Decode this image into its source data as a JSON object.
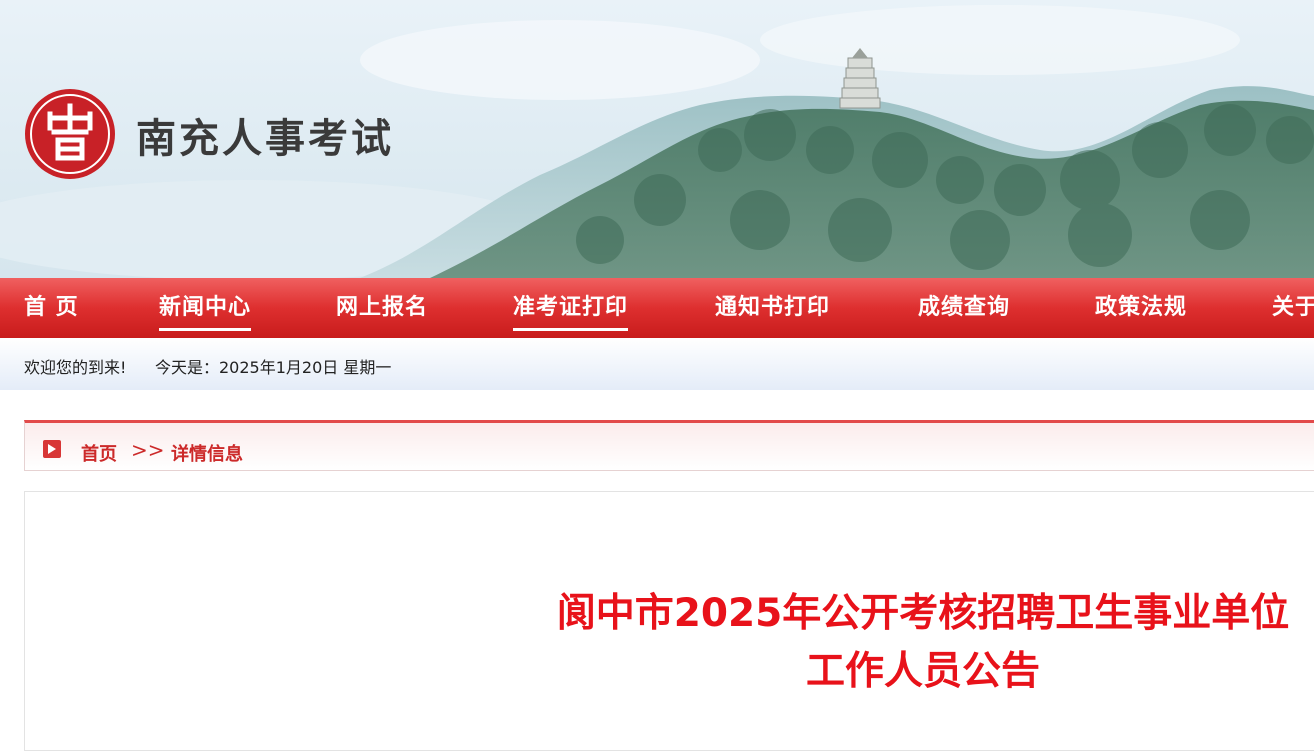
{
  "header": {
    "logo_text": "南充人事考试",
    "logo_icon": "seal-logo-icon"
  },
  "nav": {
    "items": [
      {
        "label": "首 页",
        "active": false
      },
      {
        "label": "新闻中心",
        "active": true
      },
      {
        "label": "网上报名",
        "active": false
      },
      {
        "label": "准考证打印",
        "active": true
      },
      {
        "label": "通知书打印",
        "active": false
      },
      {
        "label": "成绩查询",
        "active": false
      },
      {
        "label": "政策法规",
        "active": false
      },
      {
        "label": "关于",
        "active": false
      }
    ]
  },
  "welcome": {
    "greeting": "欢迎您的到来!",
    "today": "今天是：2025年1月20日 星期一"
  },
  "breadcrumb": {
    "home": "首页",
    "separator": ">>",
    "current": "详情信息"
  },
  "article": {
    "title_line1": "阆中市2025年公开考核招聘卫生事业单位",
    "title_line2": "工作人员公告"
  },
  "colors": {
    "brand_red": "#d82a2a",
    "title_red": "#e8121a"
  }
}
